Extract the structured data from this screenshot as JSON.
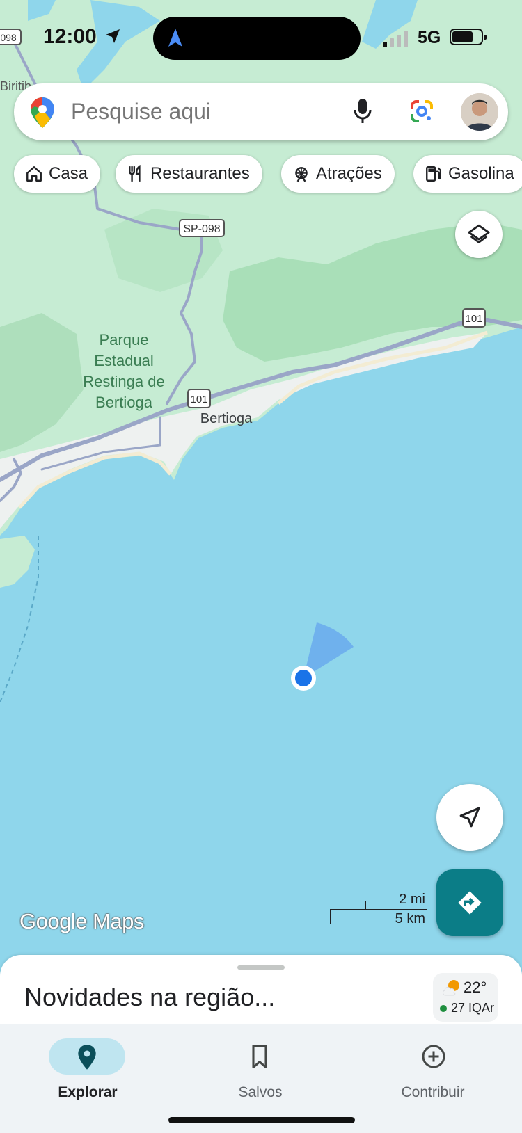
{
  "status_bar": {
    "time": "12:00",
    "network": "5G"
  },
  "search": {
    "placeholder": "Pesquise aqui"
  },
  "chips": [
    {
      "label": "Casa",
      "icon": "home-icon"
    },
    {
      "label": "Restaurantes",
      "icon": "restaurant-icon"
    },
    {
      "label": "Atrações",
      "icon": "attraction-icon"
    },
    {
      "label": "Gasolina",
      "icon": "gas-station-icon"
    }
  ],
  "map": {
    "labels": {
      "park_line1": "Parque",
      "park_line2": "Estadual",
      "park_line3": "Restinga de",
      "park_line4": "Bertioga",
      "city": "Bertioga",
      "partial_left": "Biritib",
      "shield_098_left": "098"
    },
    "road_shields": [
      "SP-098",
      "101",
      "101"
    ],
    "colors": {
      "water": "#8fd6eb",
      "land": "#c6ecd3",
      "forest": "#a9dfb8",
      "urban": "#eef1f0",
      "road": "#9aa6c7",
      "accent": "#0b7d87",
      "location": "#1a73e8"
    }
  },
  "branding": {
    "logo": "Google Maps"
  },
  "scale": {
    "miles": "2 mi",
    "km": "5 km"
  },
  "sheet": {
    "title": "Novidades na região...",
    "temperature": "22°",
    "air_quality": "27 IQAr"
  },
  "nav": [
    {
      "label": "Explorar",
      "icon": "explore-pin-icon",
      "active": true
    },
    {
      "label": "Salvos",
      "icon": "bookmark-icon",
      "active": false
    },
    {
      "label": "Contribuir",
      "icon": "add-circle-icon",
      "active": false
    }
  ]
}
